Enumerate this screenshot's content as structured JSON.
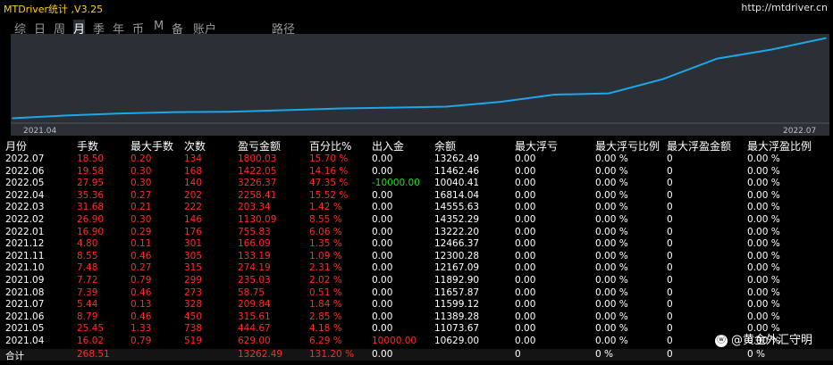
{
  "app": {
    "title": "MTDriver统计 ,V3.25",
    "url": "http://mtdriver.cn"
  },
  "tabs": [
    {
      "label": "综",
      "active": false
    },
    {
      "label": "日",
      "active": false
    },
    {
      "label": "周",
      "active": false
    },
    {
      "label": "月",
      "active": true
    },
    {
      "label": "季",
      "active": false
    },
    {
      "label": "年",
      "active": false
    },
    {
      "label": "币",
      "active": false
    },
    {
      "label": "M",
      "active": false
    },
    {
      "label": "备",
      "active": false
    },
    {
      "label": "账户",
      "active": false
    },
    {
      "label": "路径",
      "active": false
    }
  ],
  "chart_data": {
    "type": "line",
    "x": [
      "2021.04",
      "2021.05",
      "2021.06",
      "2021.07",
      "2021.08",
      "2021.09",
      "2021.10",
      "2021.11",
      "2021.12",
      "2022.01",
      "2022.02",
      "2022.03",
      "2022.04",
      "2022.05",
      "2022.06",
      "2022.07"
    ],
    "values": [
      629.0,
      1073.67,
      1389.28,
      1599.12,
      1657.87,
      1892.9,
      2167.09,
      2300.28,
      2466.37,
      3222.2,
      4352.29,
      4555.63,
      6814.04,
      10040.41,
      11462.46,
      13262.49
    ],
    "xtick_labels": [
      "2021.04",
      "2022.07"
    ],
    "color": "#1aa8e8"
  },
  "table": {
    "headers": [
      "月份",
      "手数",
      "最大手数",
      "次数",
      "盈亏金额",
      "百分比%",
      "出入金",
      "余额",
      "最大浮亏",
      "最大浮亏比例",
      "最大浮盈金额",
      "最大浮盈比例"
    ],
    "rows": [
      [
        "2022.07",
        "18.50",
        "0.20",
        "134",
        "1800.03",
        "15.70 %",
        "0.00",
        "13262.49",
        "0.00",
        "0.00 %",
        "0",
        "0.00 %"
      ],
      [
        "2022.06",
        "19.58",
        "0.30",
        "168",
        "1422.05",
        "14.16 %",
        "0.00",
        "11462.46",
        "0.00",
        "0.00 %",
        "0",
        "0.00 %"
      ],
      [
        "2022.05",
        "27.95",
        "0.30",
        "140",
        "3226.37",
        "47.35 %",
        "-10000.00",
        "10040.41",
        "0.00",
        "0.00 %",
        "0",
        "0.00 %"
      ],
      [
        "2022.04",
        "35.36",
        "0.27",
        "202",
        "2258.41",
        "15.52 %",
        "0.00",
        "16814.04",
        "0.00",
        "0.00 %",
        "0",
        "0.00 %"
      ],
      [
        "2022.03",
        "31.68",
        "0.21",
        "222",
        "203.34",
        "1.42 %",
        "0.00",
        "14555.63",
        "0.00",
        "0.00 %",
        "0",
        "0.00 %"
      ],
      [
        "2022.02",
        "26.90",
        "0.30",
        "146",
        "1130.09",
        "8.55 %",
        "0.00",
        "14352.29",
        "0.00",
        "0.00 %",
        "0",
        "0.00 %"
      ],
      [
        "2022.01",
        "16.90",
        "0.29",
        "176",
        "755.83",
        "6.06 %",
        "0.00",
        "13222.20",
        "0.00",
        "0.00 %",
        "0",
        "0.00 %"
      ],
      [
        "2021.12",
        "4.80",
        "0.11",
        "301",
        "166.09",
        "1.35 %",
        "0.00",
        "12466.37",
        "0.00",
        "0.00 %",
        "0",
        "0.00 %"
      ],
      [
        "2021.11",
        "8.55",
        "0.46",
        "305",
        "133.19",
        "1.09 %",
        "0.00",
        "12300.28",
        "0.00",
        "0.00 %",
        "0",
        "0.00 %"
      ],
      [
        "2021.10",
        "7.48",
        "0.27",
        "315",
        "274.19",
        "2.31 %",
        "0.00",
        "12167.09",
        "0.00",
        "0.00 %",
        "0",
        "0.00 %"
      ],
      [
        "2021.09",
        "7.72",
        "0.79",
        "299",
        "235.03",
        "2.02 %",
        "0.00",
        "11892.90",
        "0.00",
        "0.00 %",
        "0",
        "0.00 %"
      ],
      [
        "2021.08",
        "7.39",
        "0.46",
        "273",
        "58.75",
        "0.51 %",
        "0.00",
        "11657.87",
        "0.00",
        "0.00 %",
        "0",
        "0.00 %"
      ],
      [
        "2021.07",
        "5.44",
        "0.13",
        "328",
        "209.84",
        "1.84 %",
        "0.00",
        "11599.12",
        "0.00",
        "0.00 %",
        "0",
        "0.00 %"
      ],
      [
        "2021.06",
        "8.79",
        "0.46",
        "450",
        "315.61",
        "2.85 %",
        "0.00",
        "11389.28",
        "0.00",
        "0.00 %",
        "0",
        "0.00 %"
      ],
      [
        "2021.05",
        "25.45",
        "1.33",
        "738",
        "444.67",
        "4.18 %",
        "0.00",
        "11073.67",
        "0.00",
        "0.00 %",
        "0",
        "0.00 %"
      ],
      [
        "2021.04",
        "16.02",
        "0.79",
        "519",
        "629.00",
        "6.29 %",
        "10000.00",
        "10629.00",
        "0.00",
        "0.00 %",
        "0",
        "0.00 %"
      ]
    ],
    "total": [
      "合计",
      "268.51",
      "",
      "",
      "13262.49",
      "131.20 %",
      "0.00",
      "",
      "0",
      "0 %",
      "0",
      "0 %"
    ]
  },
  "watermark": {
    "text": "@黄金外汇守明",
    "icon": "weibo-icon"
  }
}
